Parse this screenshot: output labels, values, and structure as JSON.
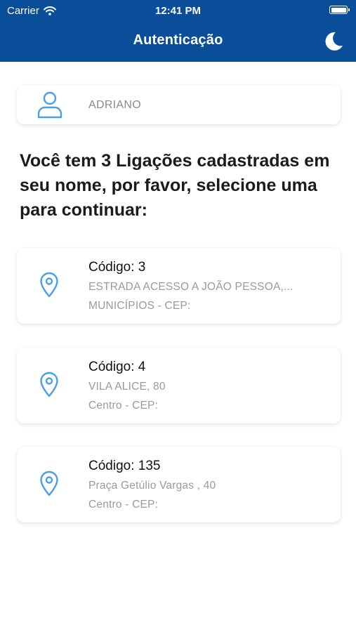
{
  "status_bar": {
    "carrier": "Carrier",
    "time": "12:41 PM"
  },
  "header": {
    "title": "Autenticação",
    "theme_icon": "moon-icon"
  },
  "user": {
    "name": "ADRIANO",
    "icon": "user-icon"
  },
  "message": "Você tem 3 Ligações cadastradas em seu nome, por favor, selecione uma para continuar:",
  "connections": [
    {
      "code": "Código: 3",
      "address": "ESTRADA ACESSO A JOÃO PESSOA,...",
      "city": "MUNICÍPIOS - CEP:"
    },
    {
      "code": "Código: 4",
      "address": "VILA ALICE, 80",
      "city": "Centro - CEP:"
    },
    {
      "code": "Código: 135",
      "address": "Praça Getúlio Vargas , 40",
      "city": "Centro - CEP:"
    }
  ],
  "colors": {
    "primary": "#0a4d98",
    "icon_blue": "#4a9fe6",
    "muted_text": "#9a9a9a"
  }
}
